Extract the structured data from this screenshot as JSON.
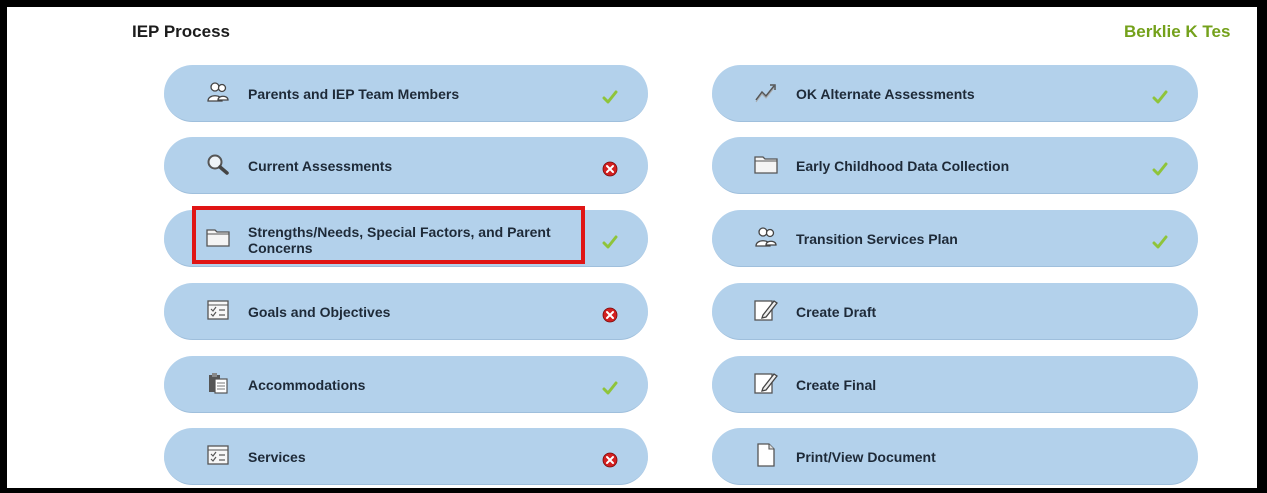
{
  "header": {
    "title": "IEP Process",
    "student_name": "Berklie K Tes"
  },
  "left_items": [
    {
      "label": "Parents and IEP Team Members",
      "icon": "people-icon",
      "status": "complete"
    },
    {
      "label": "Current Assessments",
      "icon": "magnifier-icon",
      "status": "incomplete"
    },
    {
      "label": "Strengths/Needs, Special Factors, and Parent Concerns",
      "icon": "folder-icon",
      "status": "complete"
    },
    {
      "label": "Goals and Objectives",
      "icon": "checklist-icon",
      "status": "incomplete"
    },
    {
      "label": "Accommodations",
      "icon": "clipboard-icon",
      "status": "complete"
    },
    {
      "label": "Services",
      "icon": "checklist-icon",
      "status": "incomplete"
    }
  ],
  "right_items": [
    {
      "label": "OK Alternate Assessments",
      "icon": "chart-icon",
      "status": "complete"
    },
    {
      "label": "Early Childhood Data Collection",
      "icon": "folder-icon",
      "status": "complete"
    },
    {
      "label": "Transition Services Plan",
      "icon": "people-icon",
      "status": "complete"
    },
    {
      "label": "Create Draft",
      "icon": "edit-document-icon",
      "status": "none"
    },
    {
      "label": "Create Final",
      "icon": "edit-document-icon",
      "status": "none"
    },
    {
      "label": "Print/View Document",
      "icon": "document-icon",
      "status": "none"
    }
  ],
  "highlighted_item": "Strengths/Needs, Special Factors, and Parent Concerns",
  "colors": {
    "pill": "#b3d1eb",
    "student_name": "#74a11b",
    "complete": "#8fc43a",
    "incomplete": "#d32020",
    "highlight": "#e01515"
  }
}
